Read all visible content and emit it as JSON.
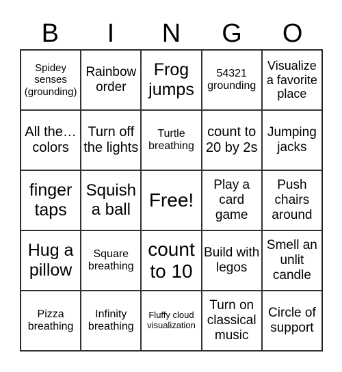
{
  "header": {
    "letters": [
      "B",
      "I",
      "N",
      "G",
      "O"
    ]
  },
  "cells": [
    "Spidey senses (grounding)",
    "Rainbow order",
    "Frog jumps",
    "54321 grounding",
    "Visualize a favorite place",
    "All the… colors",
    "Turn off the lights",
    "Turtle breathing",
    "count to 20 by 2s",
    "Jumping jacks",
    "finger taps",
    "Squish a ball",
    "Free!",
    "Play a card game",
    "Push chairs around",
    "Hug a pillow",
    "Square breathing",
    "count to 10",
    "Build with legos",
    "Smell an unlit candle",
    "Pizza breathing",
    "Infinity breathing",
    "Fluffy cloud visualization",
    "Turn on classical music",
    "Circle of support"
  ]
}
